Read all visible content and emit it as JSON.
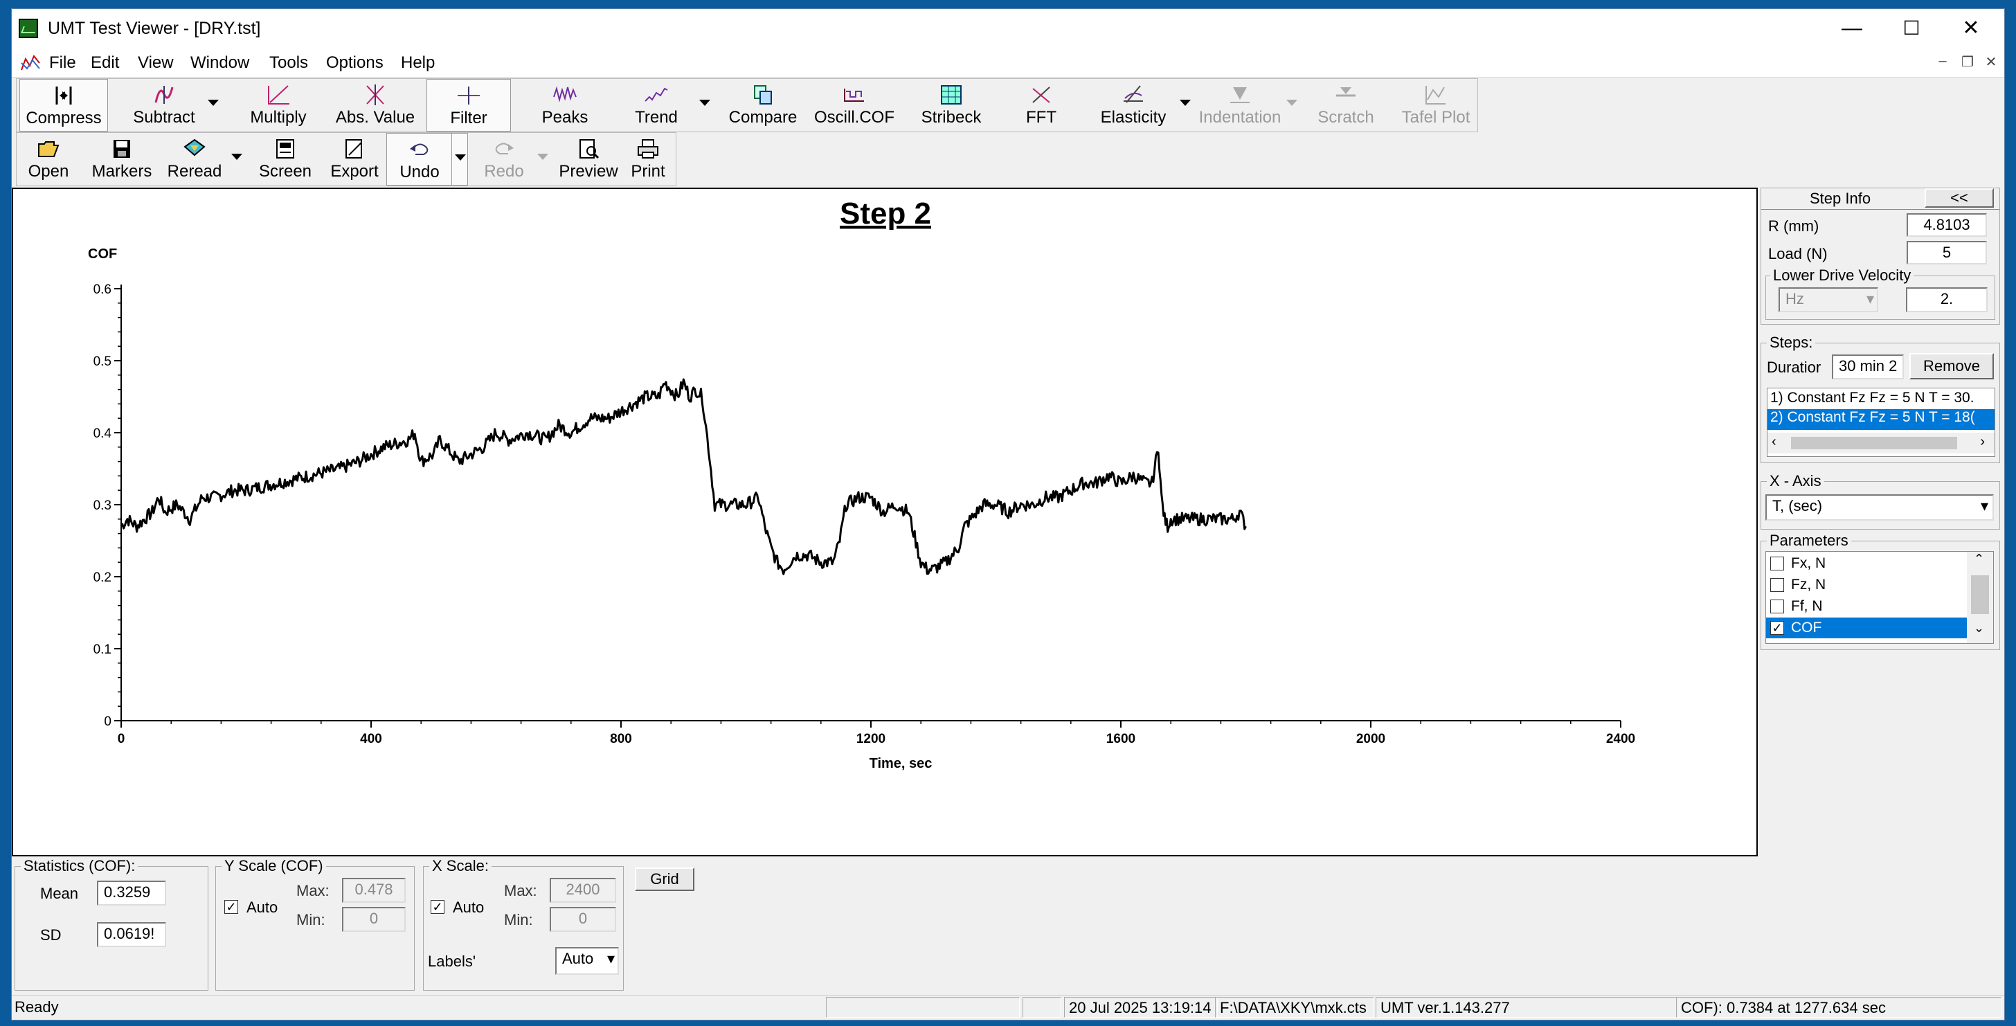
{
  "window": {
    "title": "UMT Test Viewer - [DRY.tst]",
    "minimize": "—",
    "maximize": "☐",
    "close": "✕"
  },
  "menu": [
    "File",
    "Edit",
    "View",
    "Window",
    "Tools",
    "Options",
    "Help"
  ],
  "toolbar1": [
    {
      "label": "Compress",
      "icon": "compress-icon"
    },
    {
      "label": "Subtract",
      "icon": "subtract-icon"
    },
    {
      "label": "Multiply",
      "icon": "multiply-icon"
    },
    {
      "label": "Abs. Value",
      "icon": "abs-value-icon"
    },
    {
      "label": "Filter",
      "icon": "filter-icon"
    },
    {
      "label": "Peaks",
      "icon": "peaks-icon"
    },
    {
      "label": "Trend",
      "icon": "trend-icon"
    },
    {
      "label": "Compare",
      "icon": "compare-icon"
    },
    {
      "label": "Oscill.COF",
      "icon": "oscill-cof-icon"
    },
    {
      "label": "Stribeck",
      "icon": "stribeck-icon"
    },
    {
      "label": "FFT",
      "icon": "fft-icon"
    },
    {
      "label": "Elasticity",
      "icon": "elasticity-icon"
    },
    {
      "label": "Indentation",
      "icon": "indentation-icon"
    },
    {
      "label": "Scratch",
      "icon": "scratch-icon"
    },
    {
      "label": "Tafel Plot",
      "icon": "tafel-plot-icon"
    }
  ],
  "toolbar2": [
    {
      "label": "Open",
      "icon": "folder-open-icon"
    },
    {
      "label": "Markers",
      "icon": "markers-icon"
    },
    {
      "label": "Reread",
      "icon": "reread-icon"
    },
    {
      "label": "Screen",
      "icon": "screen-icon"
    },
    {
      "label": "Export",
      "icon": "export-icon"
    },
    {
      "label": "Undo",
      "icon": "undo-icon"
    },
    {
      "label": "Redo",
      "icon": "redo-icon"
    },
    {
      "label": "Preview",
      "icon": "preview-icon"
    },
    {
      "label": "Print",
      "icon": "print-icon"
    }
  ],
  "chart_data": {
    "type": "line",
    "title": "Step 2",
    "xlabel": "Time, sec",
    "ylabel": "COF",
    "xlim": [
      0,
      2400
    ],
    "ylim": [
      0,
      0.6
    ],
    "xticks": [
      "0",
      "400",
      "800",
      "1200",
      "1600",
      "2000",
      "2400"
    ],
    "yticks": [
      "0",
      "0.1",
      "0.2",
      "0.3",
      "0.4",
      "0.5",
      "0.6"
    ],
    "grid": false,
    "series": [
      {
        "color": "#000000",
        "x": [
          0,
          10,
          25,
          50,
          60,
          70,
          90,
          110,
          130,
          150,
          180,
          200,
          250,
          300,
          350,
          380,
          400,
          420,
          460,
          470,
          480,
          500,
          510,
          520,
          540,
          560,
          580,
          600,
          620,
          650,
          680,
          700,
          720,
          750,
          780,
          800,
          820,
          840,
          860,
          870,
          880,
          890,
          900,
          910,
          920,
          930,
          940,
          950,
          960,
          980,
          1000,
          1020,
          1030,
          1040,
          1050,
          1060,
          1080,
          1100,
          1120,
          1140,
          1150,
          1160,
          1180,
          1200,
          1220,
          1240,
          1260,
          1280,
          1290,
          1300,
          1320,
          1340,
          1350,
          1360,
          1380,
          1400,
          1420,
          1440,
          1460,
          1480,
          1500,
          1520,
          1540,
          1560,
          1580,
          1600,
          1620,
          1640,
          1650,
          1660,
          1665,
          1670,
          1675,
          1680,
          1700,
          1720,
          1740,
          1760,
          1780,
          1790,
          1800
        ],
        "y": [
          0.27,
          0.28,
          0.27,
          0.29,
          0.31,
          0.29,
          0.3,
          0.28,
          0.31,
          0.31,
          0.32,
          0.32,
          0.33,
          0.34,
          0.35,
          0.36,
          0.37,
          0.38,
          0.39,
          0.4,
          0.36,
          0.37,
          0.39,
          0.38,
          0.36,
          0.37,
          0.38,
          0.4,
          0.39,
          0.4,
          0.39,
          0.41,
          0.4,
          0.42,
          0.42,
          0.43,
          0.44,
          0.45,
          0.45,
          0.47,
          0.46,
          0.45,
          0.47,
          0.45,
          0.46,
          0.45,
          0.38,
          0.3,
          0.3,
          0.3,
          0.3,
          0.31,
          0.27,
          0.24,
          0.22,
          0.21,
          0.23,
          0.23,
          0.22,
          0.22,
          0.25,
          0.3,
          0.31,
          0.31,
          0.29,
          0.3,
          0.29,
          0.22,
          0.21,
          0.21,
          0.22,
          0.24,
          0.27,
          0.28,
          0.3,
          0.3,
          0.29,
          0.3,
          0.3,
          0.31,
          0.31,
          0.32,
          0.33,
          0.33,
          0.34,
          0.33,
          0.34,
          0.33,
          0.33,
          0.38,
          0.31,
          0.28,
          0.27,
          0.28,
          0.28,
          0.28,
          0.28,
          0.28,
          0.28,
          0.29,
          0.27
        ]
      }
    ]
  },
  "step_info": {
    "header": "Step Info",
    "collapse": "<<",
    "r_label": "R (mm)",
    "r_value": "4.8103",
    "load_label": "Load (N)",
    "load_value": "5",
    "lower_drive_label": "Lower Drive Velocity",
    "unit_value": "Hz",
    "velocity_value": "2."
  },
  "steps": {
    "label": "Steps:",
    "duration_label": "Duratior",
    "duration_value": "30 min 2",
    "remove_label": "Remove",
    "items": [
      "1) Constant Fz Fz = 5 N T = 30.",
      "2) Constant Fz Fz = 5 N T = 18("
    ]
  },
  "x_axis": {
    "label": "X - Axis",
    "value": "T, (sec)"
  },
  "parameters": {
    "label": "Parameters",
    "items": [
      {
        "label": "Fx, N",
        "checked": false
      },
      {
        "label": "Fz, N",
        "checked": false
      },
      {
        "label": "Ff, N",
        "checked": false
      },
      {
        "label": "COF",
        "checked": true
      }
    ]
  },
  "statistics": {
    "label": "Statistics (COF):",
    "mean_label": "Mean",
    "mean_value": "0.3259",
    "sd_label": "SD",
    "sd_value": "0.0619!"
  },
  "y_scale": {
    "label": "Y Scale (COF)",
    "auto_label": "Auto",
    "max_label": "Max:",
    "max_value": "0.478",
    "min_label": "Min:",
    "min_value": "0"
  },
  "x_scale": {
    "label": "X Scale:",
    "auto_label": "Auto",
    "max_label": "Max:",
    "max_value": "2400",
    "min_label": "Min:",
    "min_value": "0",
    "labels_label": "Labels'",
    "labels_value": "Auto"
  },
  "grid_button": "Grid",
  "status": {
    "ready": "Ready",
    "datetime": "20 Jul 2025 13:19:14",
    "path": "F:\\DATA\\XKY\\mxk.cts",
    "version": "UMT ver.1.143.277",
    "readout": "COF): 0.7384 at 1277.634 sec"
  }
}
